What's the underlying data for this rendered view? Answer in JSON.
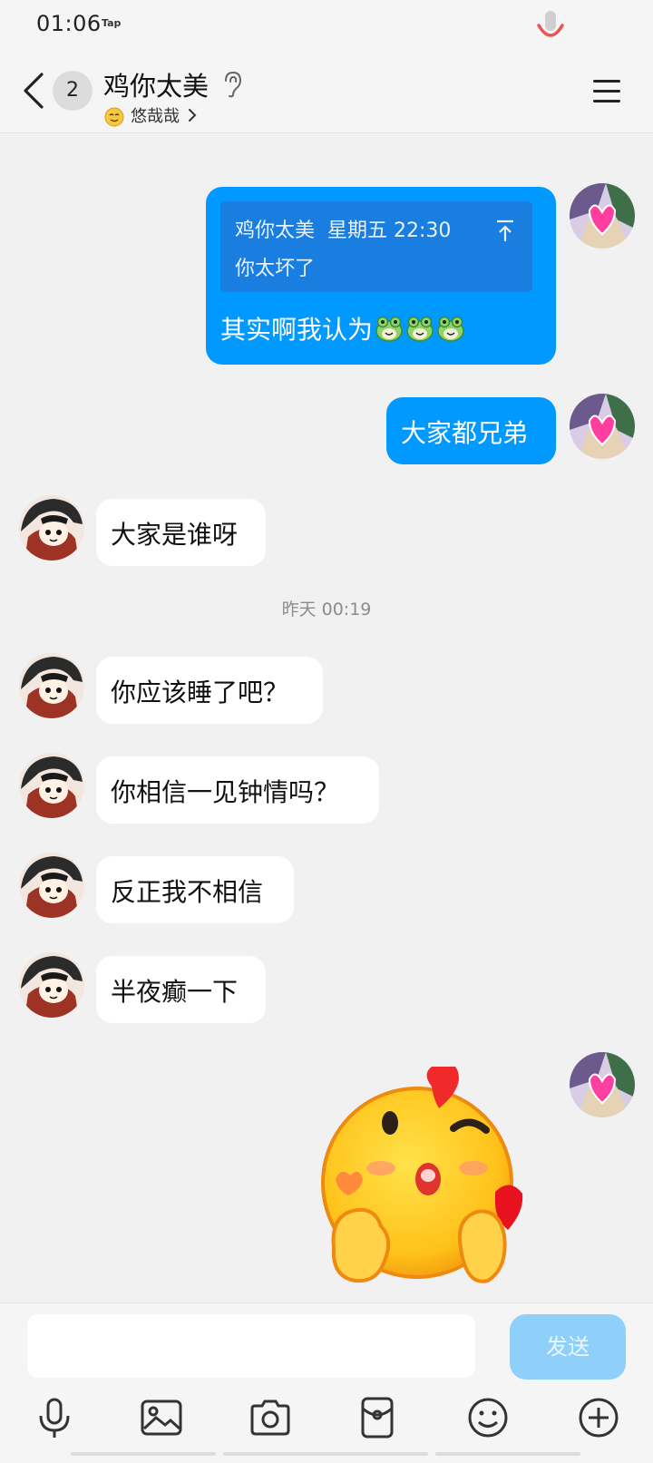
{
  "status_bar": {
    "time": "01:06",
    "tap_label": "Tap"
  },
  "header": {
    "unread_count": "2",
    "title": "鸡你太美",
    "subtitle": "悠哉哉"
  },
  "messages": [
    {
      "side": "right",
      "quote": {
        "author": "鸡你太美",
        "time": "星期五 22:30",
        "text": "你太坏了"
      },
      "text": "其实啊我认为",
      "emojis": [
        "frog-emoji",
        "frog-emoji",
        "frog-emoji"
      ]
    },
    {
      "side": "right",
      "text": "大家都兄弟"
    },
    {
      "side": "left",
      "text": "大家是谁呀"
    },
    {
      "side": "left",
      "text": "你应该睡了吧？"
    },
    {
      "side": "left",
      "text": "你相信一见钟情吗？"
    },
    {
      "side": "left",
      "text": "反正我不相信"
    },
    {
      "side": "left",
      "text": "半夜癫一下"
    },
    {
      "side": "right",
      "sticker": "kiss-heart-emoji-sticker"
    }
  ],
  "timestamp": "昨天 00:19",
  "input": {
    "placeholder": "",
    "send_label": "发送"
  },
  "toolbar": [
    "mic-icon",
    "image-icon",
    "camera-icon",
    "red-packet-icon",
    "emoji-icon",
    "plus-icon"
  ],
  "colors": {
    "accent": "#0099ff",
    "background": "#f1f1f1",
    "bubble_left": "#ffffff",
    "send_disabled": "#8fd0fb"
  }
}
